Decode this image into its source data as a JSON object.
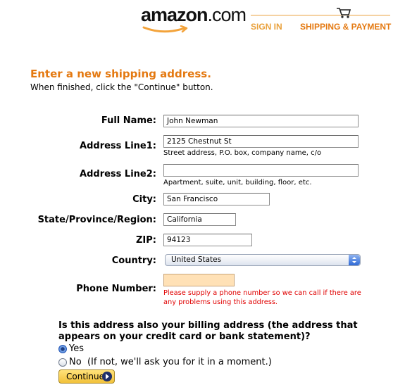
{
  "header": {
    "logo_main": "amazon",
    "logo_dotcom": ".com",
    "steps": [
      {
        "label": "SIGN IN",
        "state": "completed",
        "color": "#e9a13c"
      },
      {
        "label": "SHIPPING & PAYMENT",
        "state": "current",
        "color": "#e47911"
      }
    ],
    "cart_icon": "shopping-cart-icon"
  },
  "page": {
    "heading": "Enter a new shipping address.",
    "subheading": "When finished, click the \"Continue\" button."
  },
  "form": {
    "full_name": {
      "label": "Full Name:",
      "value": "John Newman"
    },
    "address1": {
      "label": "Address Line1:",
      "value": "2125 Chestnut St",
      "hint": "Street address, P.O. box, company name, c/o"
    },
    "address2": {
      "label": "Address Line2:",
      "value": "",
      "hint": "Apartment, suite, unit, building, floor, etc."
    },
    "city": {
      "label": "City:",
      "value": "San Francisco"
    },
    "state": {
      "label": "State/Province/Region:",
      "value": "California"
    },
    "zip": {
      "label": "ZIP:",
      "value": "94123"
    },
    "country": {
      "label": "Country:",
      "value": "United States"
    },
    "phone": {
      "label": "Phone Number:",
      "value": "",
      "error": "Please supply a phone number so we can call if there are any problems using this address.",
      "highlight_color": "#ffe1b6"
    }
  },
  "billing": {
    "question": "Is this address also your billing address (the address that appears on your credit card or bank statement)?",
    "options": [
      {
        "label": "Yes",
        "selected": true
      },
      {
        "label": "No  (If not, we'll ask you for it in a moment.)",
        "selected": false
      }
    ]
  },
  "actions": {
    "continue_label": "Continue"
  },
  "colors": {
    "accent": "#e47911",
    "error": "#e00000"
  }
}
